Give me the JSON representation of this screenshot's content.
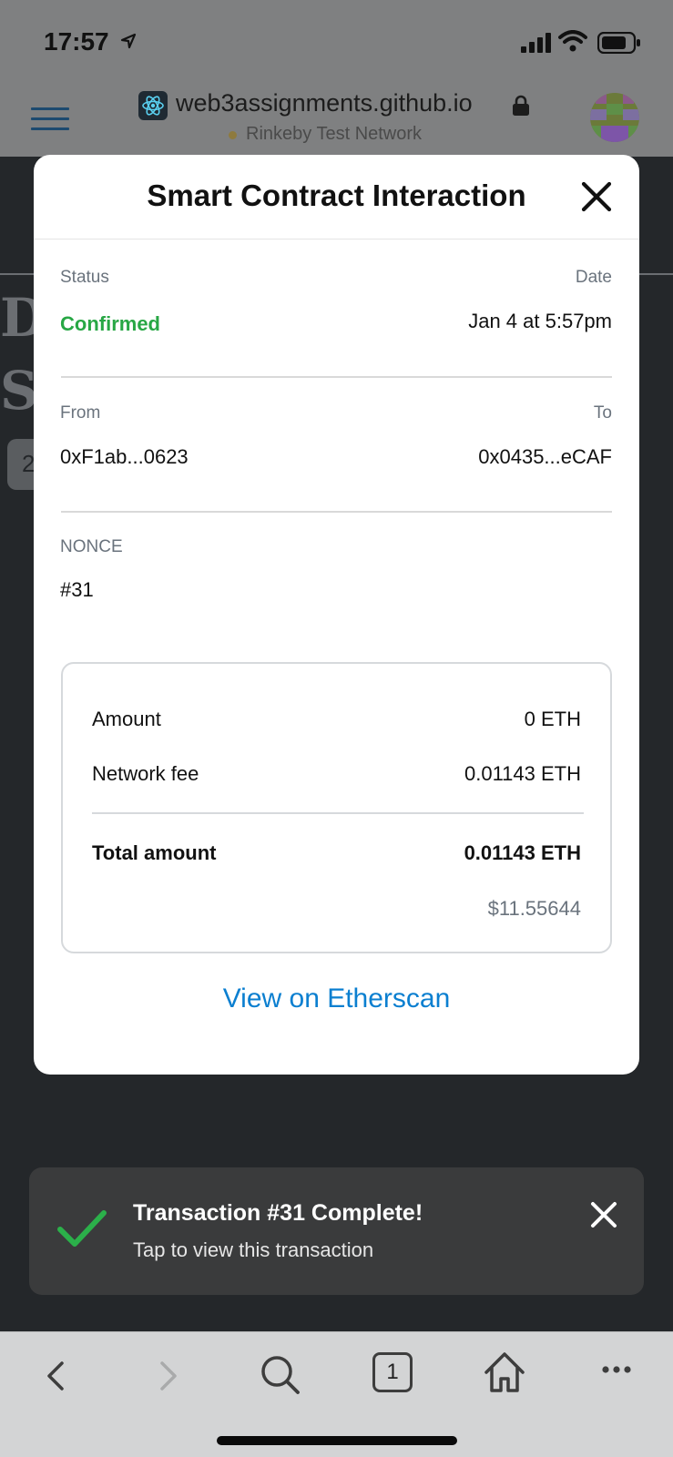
{
  "status_bar": {
    "time": "17:57"
  },
  "browser": {
    "url": "web3assignments.github.io",
    "network": "Rinkeby Test Network"
  },
  "background_page": {
    "ghost_letter_1": "D",
    "ghost_letter_2": "S",
    "ghost_chip": "2"
  },
  "modal": {
    "title": "Smart Contract Interaction",
    "status_label": "Status",
    "status_value": "Confirmed",
    "date_label": "Date",
    "date_value": "Jan 4 at 5:57pm",
    "from_label": "From",
    "from_value": "0xF1ab...0623",
    "to_label": "To",
    "to_value": "0x0435...eCAF",
    "nonce_label": "NONCE",
    "nonce_value": "#31",
    "fees": {
      "amount_label": "Amount",
      "amount_value": "0 ETH",
      "network_fee_label": "Network fee",
      "network_fee_value": "0.01143 ETH",
      "total_label": "Total amount",
      "total_value": "0.01143 ETH",
      "total_usd": "$11.55644"
    },
    "etherscan_link": "View on Etherscan"
  },
  "toast": {
    "title": "Transaction #31 Complete!",
    "subtitle": "Tap to view this transaction"
  },
  "toolbar": {
    "tab_count": "1"
  },
  "colors": {
    "confirmed": "#28a745",
    "link": "#0b7fd0",
    "toast_bg": "#3a3b3c",
    "check": "#2bb04a"
  }
}
